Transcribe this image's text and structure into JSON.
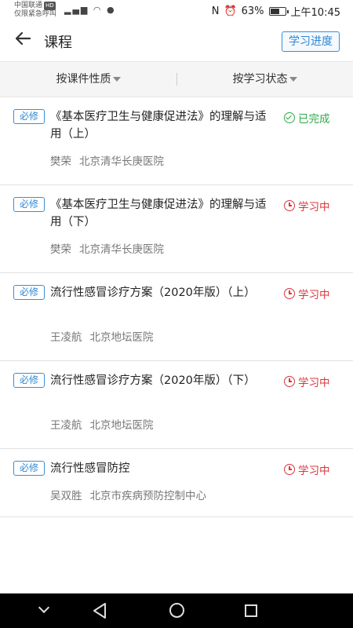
{
  "status_bar": {
    "carrier": "中国联通",
    "hd": "HD",
    "emergency": "仅限紧急呼叫",
    "battery": "63%",
    "time": "上午10:45"
  },
  "header": {
    "title": "课程",
    "progress_button": "学习进度"
  },
  "filters": [
    {
      "label": "按课件性质"
    },
    {
      "label": "按学习状态"
    }
  ],
  "courses": [
    {
      "badge": "必修",
      "title": "《基本医疗卫生与健康促进法》的理解与适用（上）",
      "lecturer": "樊荣",
      "hospital": "北京清华长庚医院",
      "status": "已完成",
      "status_type": "done"
    },
    {
      "badge": "必修",
      "title": "《基本医疗卫生与健康促进法》的理解与适用（下）",
      "lecturer": "樊荣",
      "hospital": "北京清华长庚医院",
      "status": "学习中",
      "status_type": "learning"
    },
    {
      "badge": "必修",
      "title": "流行性感冒诊疗方案（2020年版）（上）",
      "lecturer": "王凌航",
      "hospital": "北京地坛医院",
      "status": "学习中",
      "status_type": "learning"
    },
    {
      "badge": "必修",
      "title": "流行性感冒诊疗方案（2020年版）（下）",
      "lecturer": "王凌航",
      "hospital": "北京地坛医院",
      "status": "学习中",
      "status_type": "learning"
    },
    {
      "badge": "必修",
      "title": "流行性感冒防控",
      "lecturer": "吴双胜",
      "hospital": "北京市疾病预防控制中心",
      "status": "学习中",
      "status_type": "learning"
    }
  ],
  "colors": {
    "accent": "#2f88d4",
    "done": "#2eaa4a",
    "learning": "#d9363e"
  }
}
